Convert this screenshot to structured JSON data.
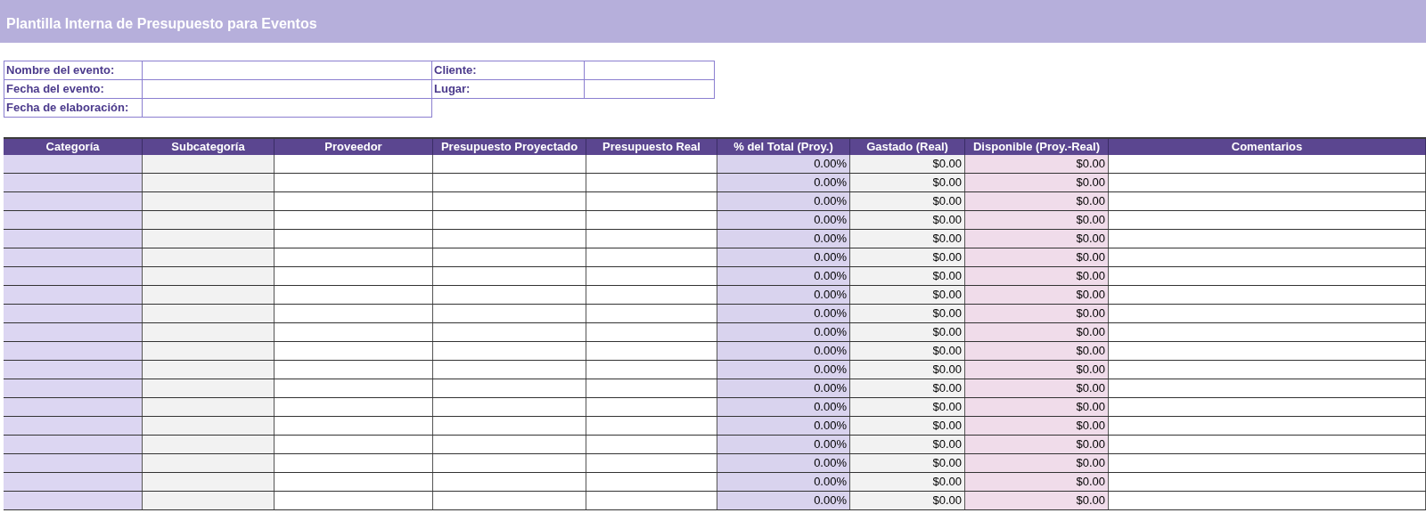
{
  "title": "Plantilla Interna de Presupuesto para Eventos",
  "info_rows": [
    [
      "Nombre del evento:",
      "Cliente:"
    ],
    [
      "Fecha del evento:",
      "Lugar:"
    ],
    [
      "Fecha de elaboración:"
    ]
  ],
  "table": {
    "columns": [
      "Categoría",
      "Subcategoría",
      "Proveedor",
      "Presupuesto Proyectado",
      "Presupuesto Real",
      "% del Total (Proy.)",
      "Gastado (Real)",
      "Disponible (Proy.-Real)",
      "Comentarios"
    ],
    "rows": [
      {
        "pct": "0.00%",
        "spent": "$0.00",
        "available": "$0.00"
      },
      {
        "pct": "0.00%",
        "spent": "$0.00",
        "available": "$0.00"
      },
      {
        "pct": "0.00%",
        "spent": "$0.00",
        "available": "$0.00"
      },
      {
        "pct": "0.00%",
        "spent": "$0.00",
        "available": "$0.00"
      },
      {
        "pct": "0.00%",
        "spent": "$0.00",
        "available": "$0.00"
      },
      {
        "pct": "0.00%",
        "spent": "$0.00",
        "available": "$0.00"
      },
      {
        "pct": "0.00%",
        "spent": "$0.00",
        "available": "$0.00"
      },
      {
        "pct": "0.00%",
        "spent": "$0.00",
        "available": "$0.00"
      },
      {
        "pct": "0.00%",
        "spent": "$0.00",
        "available": "$0.00"
      },
      {
        "pct": "0.00%",
        "spent": "$0.00",
        "available": "$0.00"
      },
      {
        "pct": "0.00%",
        "spent": "$0.00",
        "available": "$0.00"
      },
      {
        "pct": "0.00%",
        "spent": "$0.00",
        "available": "$0.00"
      },
      {
        "pct": "0.00%",
        "spent": "$0.00",
        "available": "$0.00"
      },
      {
        "pct": "0.00%",
        "spent": "$0.00",
        "available": "$0.00"
      },
      {
        "pct": "0.00%",
        "spent": "$0.00",
        "available": "$0.00"
      },
      {
        "pct": "0.00%",
        "spent": "$0.00",
        "available": "$0.00"
      },
      {
        "pct": "0.00%",
        "spent": "$0.00",
        "available": "$0.00"
      },
      {
        "pct": "0.00%",
        "spent": "$0.00",
        "available": "$0.00"
      },
      {
        "pct": "0.00%",
        "spent": "$0.00",
        "available": "$0.00"
      }
    ]
  }
}
